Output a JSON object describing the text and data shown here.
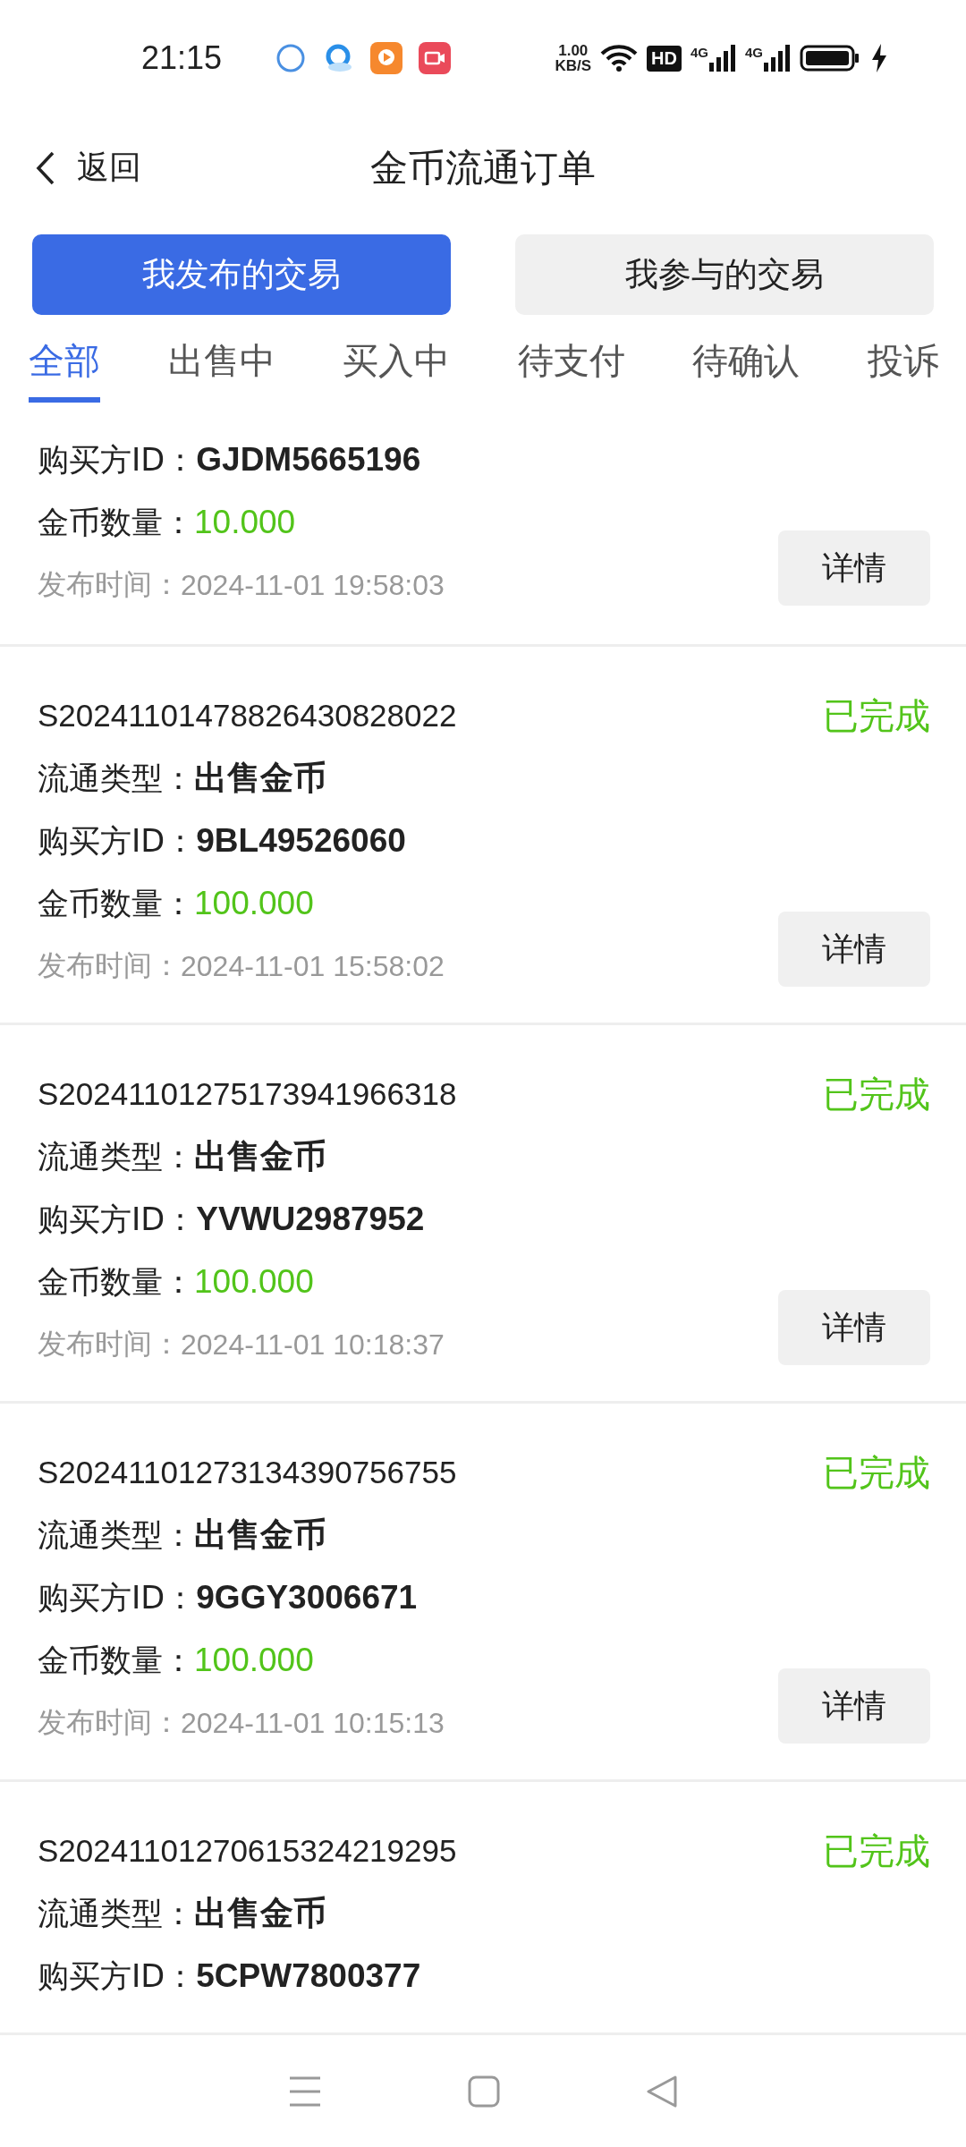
{
  "status_bar": {
    "time": "21:15",
    "speed_value": "1.00",
    "speed_unit": "KB/S",
    "hd": "HD",
    "networks": [
      "4G",
      "4G"
    ]
  },
  "header": {
    "back": "返回",
    "title": "金币流通订单"
  },
  "segments": [
    {
      "label": "我发布的交易",
      "selected": true
    },
    {
      "label": "我参与的交易",
      "selected": false
    }
  ],
  "tabs": [
    {
      "label": "全部",
      "selected": true
    },
    {
      "label": "出售中",
      "selected": false
    },
    {
      "label": "买入中",
      "selected": false
    },
    {
      "label": "待支付",
      "selected": false
    },
    {
      "label": "待确认",
      "selected": false
    },
    {
      "label": "投诉",
      "selected": false
    }
  ],
  "orders": [
    {
      "buyer_label": "购买方ID：",
      "buyer_id": "GJDM5665196",
      "amount_label": "金币数量：",
      "amount": "10.000",
      "time_label": "发布时间：",
      "time": "2024-11-01 19:58:03",
      "button": "详情"
    },
    {
      "order_no": "S20241101478826430828022",
      "status": "已完成",
      "type_label": "流通类型：",
      "type": "出售金币",
      "buyer_label": "购买方ID：",
      "buyer_id": "9BL49526060",
      "amount_label": "金币数量：",
      "amount": "100.000",
      "time_label": "发布时间：",
      "time": "2024-11-01 15:58:02",
      "button": "详情"
    },
    {
      "order_no": "S20241101275173941966318",
      "status": "已完成",
      "type_label": "流通类型：",
      "type": "出售金币",
      "buyer_label": "购买方ID：",
      "buyer_id": "YVWU2987952",
      "amount_label": "金币数量：",
      "amount": "100.000",
      "time_label": "发布时间：",
      "time": "2024-11-01 10:18:37",
      "button": "详情"
    },
    {
      "order_no": "S20241101273134390756755",
      "status": "已完成",
      "type_label": "流通类型：",
      "type": "出售金币",
      "buyer_label": "购买方ID：",
      "buyer_id": "9GGY3006671",
      "amount_label": "金币数量：",
      "amount": "100.000",
      "time_label": "发布时间：",
      "time": "2024-11-01 10:15:13",
      "button": "详情"
    },
    {
      "order_no": "S20241101270615324219295",
      "status": "已完成",
      "type_label": "流通类型：",
      "type": "出售金币",
      "buyer_label": "购买方ID：",
      "buyer_id": "5CPW7800377"
    }
  ]
}
